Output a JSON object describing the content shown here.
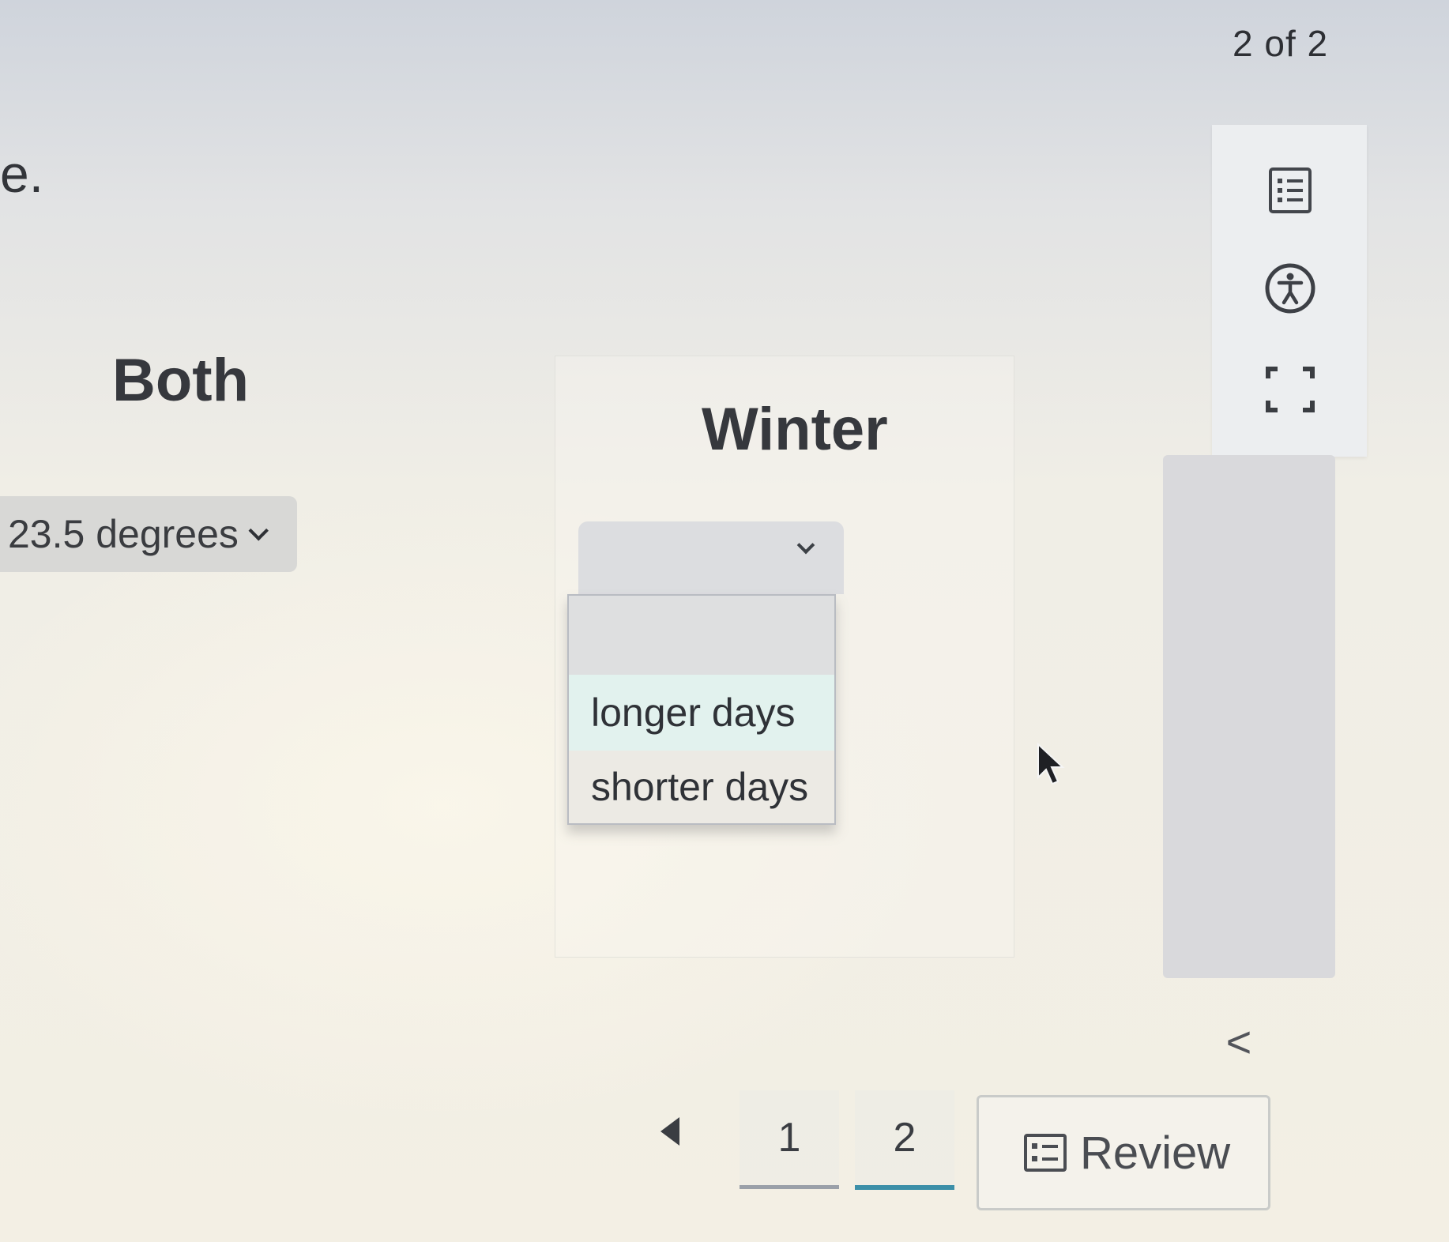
{
  "header": {
    "page_counter": "2 of 2"
  },
  "question": {
    "stem_tail": "e."
  },
  "columns": [
    {
      "header": "Both",
      "select_value": "23.5 degrees"
    },
    {
      "header": "Winter",
      "select_value": "",
      "dropdown_open": true,
      "options": [
        "",
        "longer days",
        "shorter days"
      ],
      "highlighted_option": "longer days"
    }
  ],
  "toolbar": {
    "icons": [
      "list-icon",
      "accessibility-icon",
      "fullscreen-icon"
    ]
  },
  "navigation": {
    "collapse_symbol": "<",
    "pages": [
      "1",
      "2"
    ],
    "current_page": "2",
    "review_label": "Review"
  },
  "colors": {
    "active_tab_underline": "#3c8fa8",
    "highlighted_option_bg": "#e2f2ee"
  }
}
